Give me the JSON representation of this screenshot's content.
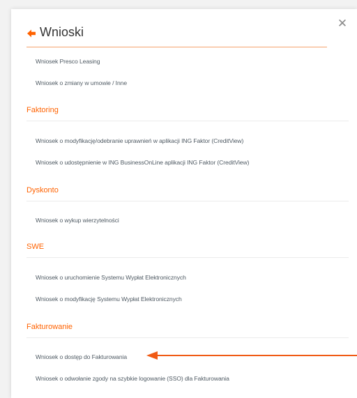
{
  "dialog": {
    "title": "Wnioski",
    "close_label": "✕",
    "back_icon": "back-arrow-icon",
    "accent_color": "#ff6200"
  },
  "top_links": [
    "Wniosek Presco Leasing",
    "Wniosek o zmiany w umowie / Inne"
  ],
  "sections": [
    {
      "title": "Faktoring",
      "links": [
        "Wniosek o modyfikację/odebranie uprawnień w aplikacji ING Faktor (CreditView)",
        "Wniosek o udostępnienie w ING BusinessOnLine aplikacji ING Faktor (CreditView)"
      ]
    },
    {
      "title": "Dyskonto",
      "links": [
        "Wniosek o wykup wierzytelności"
      ]
    },
    {
      "title": "SWE",
      "links": [
        "Wniosek o uruchomienie Systemu Wypłat Elektronicznych",
        "Wniosek o modyfikację Systemu Wypłat Elektronicznych"
      ]
    },
    {
      "title": "Fakturowanie",
      "links": [
        "Wniosek o dostęp do Fakturowania",
        "Wniosek o odwołanie zgody na szybkie logowanie (SSO) dla Fakturowania"
      ]
    }
  ],
  "annotation": {
    "arrow_icon": "pointer-arrow-icon",
    "arrow_color": "#f05a14"
  }
}
